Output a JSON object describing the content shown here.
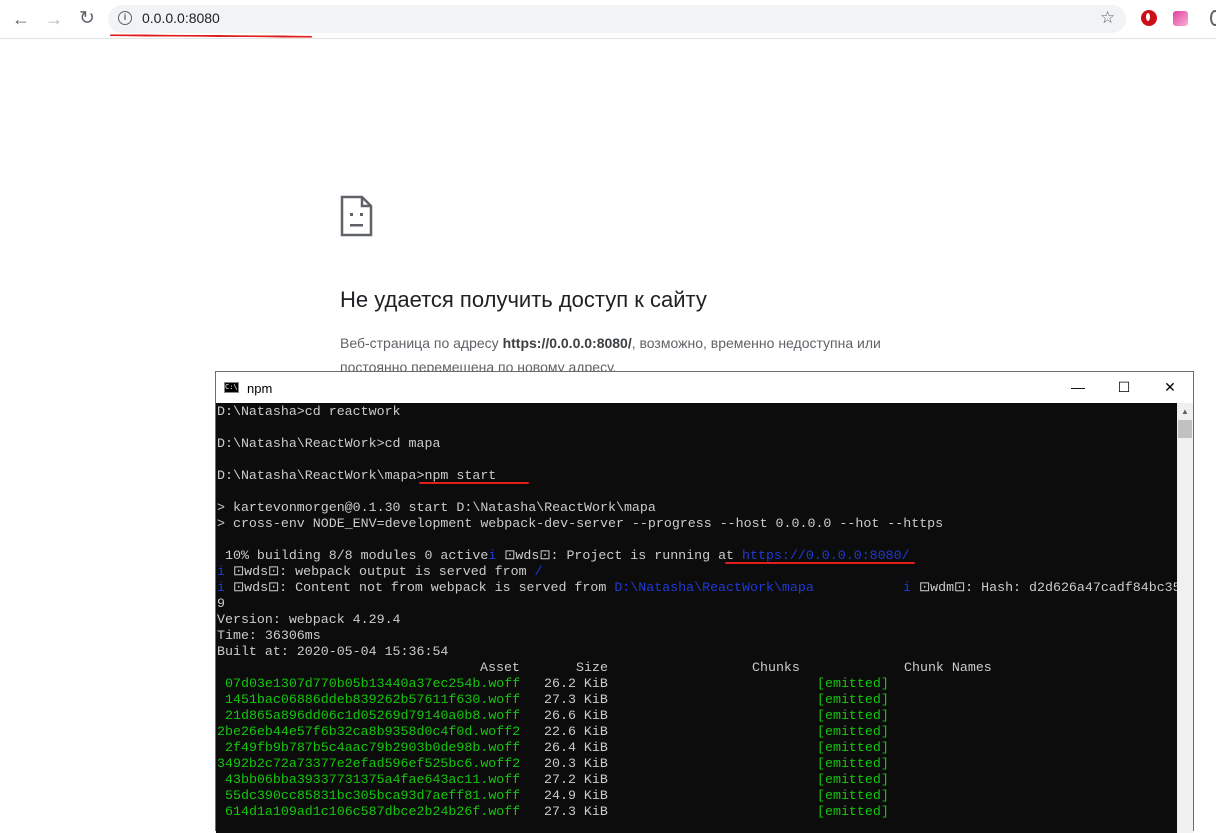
{
  "browser": {
    "url": "0.0.0.0:8080",
    "icons": [
      "back-arrow-icon",
      "forward-arrow-icon",
      "reload-icon",
      "info-icon",
      "star-icon",
      "opera-extension-icon",
      "extension-icon",
      "profile-icon"
    ]
  },
  "error_page": {
    "title": "Не удается получить доступ к сайту",
    "desc_pre": "Веб-страница по адресу ",
    "desc_url": "https://0.0.0.0:8080/",
    "desc_post": ", возможно, временно недоступна или постоянно перемещена по новому адресу."
  },
  "console": {
    "title": "npm",
    "min_glyph": "—",
    "max_glyph": "☐",
    "close_glyph": "✕",
    "lines": {
      "l1": "D:\\Natasha>cd reactwork",
      "l2": "D:\\Natasha\\ReactWork>cd mapa",
      "l3a": "D:\\Natasha\\ReactWork\\mapa>",
      "l3b": "npm start",
      "l4": "> kartevonmorgen@0.1.30 start D:\\Natasha\\ReactWork\\mapa",
      "l5": "> cross-env NODE_ENV=development webpack-dev-server --progress --host 0.0.0.0 --hot --https",
      "l6a": " 10% building 8/8 modules 0 active",
      "l6b": "i",
      "l6c": " ⊡wds⊡: Project is running at ",
      "l6d": "https://0.0.0.0:8080/",
      "l7a": "i",
      "l7b": " ⊡wds⊡: webpack output is served from ",
      "l7c": "/",
      "l8a": "i",
      "l8b": " ⊡wds⊡: Content not from webpack is served from ",
      "l8c": "D:\\Natasha\\ReactWork\\mapa",
      "l8d": "i",
      "l8e": " ⊡wdm⊡: Hash: d2d626a47cadf84bc35",
      "l9": "9",
      "l10": "Version: webpack 4.29.4",
      "l11": "Time: 36306ms",
      "l12": "Built at: 2020-05-04 15:36:54"
    },
    "table_header": [
      "Asset",
      "Size",
      "Chunks",
      "Chunk Names"
    ],
    "assets": [
      {
        "asset": "07d03e1307d770b05b13440a37ec254b.woff",
        "size": "26.2 KiB",
        "status": "[emitted]"
      },
      {
        "asset": "1451bac06886ddeb839262b57611f630.woff",
        "size": "27.3 KiB",
        "status": "[emitted]"
      },
      {
        "asset": "21d865a896dd06c1d05269d79140a0b8.woff",
        "size": "26.6 KiB",
        "status": "[emitted]"
      },
      {
        "asset": "2be26eb44e57f6b32ca8b9358d0c4f0d.woff2",
        "size": "22.6 KiB",
        "status": "[emitted]"
      },
      {
        "asset": "2f49fb9b787b5c4aac79b2903b0de98b.woff",
        "size": "26.4 KiB",
        "status": "[emitted]"
      },
      {
        "asset": "3492b2c72a73377e2efad596ef525bc6.woff2",
        "size": "20.3 KiB",
        "status": "[emitted]"
      },
      {
        "asset": "43bb06bba39337731375a4fae643ac11.woff",
        "size": "27.2 KiB",
        "status": "[emitted]"
      },
      {
        "asset": "55dc390cc85831bc305bca93d7aeff81.woff",
        "size": "24.9 KiB",
        "status": "[emitted]"
      },
      {
        "asset": "614d1a109ad1c106c587dbce2b24b26f.woff",
        "size": "27.3 KiB",
        "status": "[emitted]"
      }
    ]
  },
  "colors": {
    "annotation_red": "#e01e1e",
    "console_bg": "#0c0c0c",
    "console_text": "#cccccc",
    "console_green": "#16c60c",
    "console_blue": "#1f3ad6"
  }
}
